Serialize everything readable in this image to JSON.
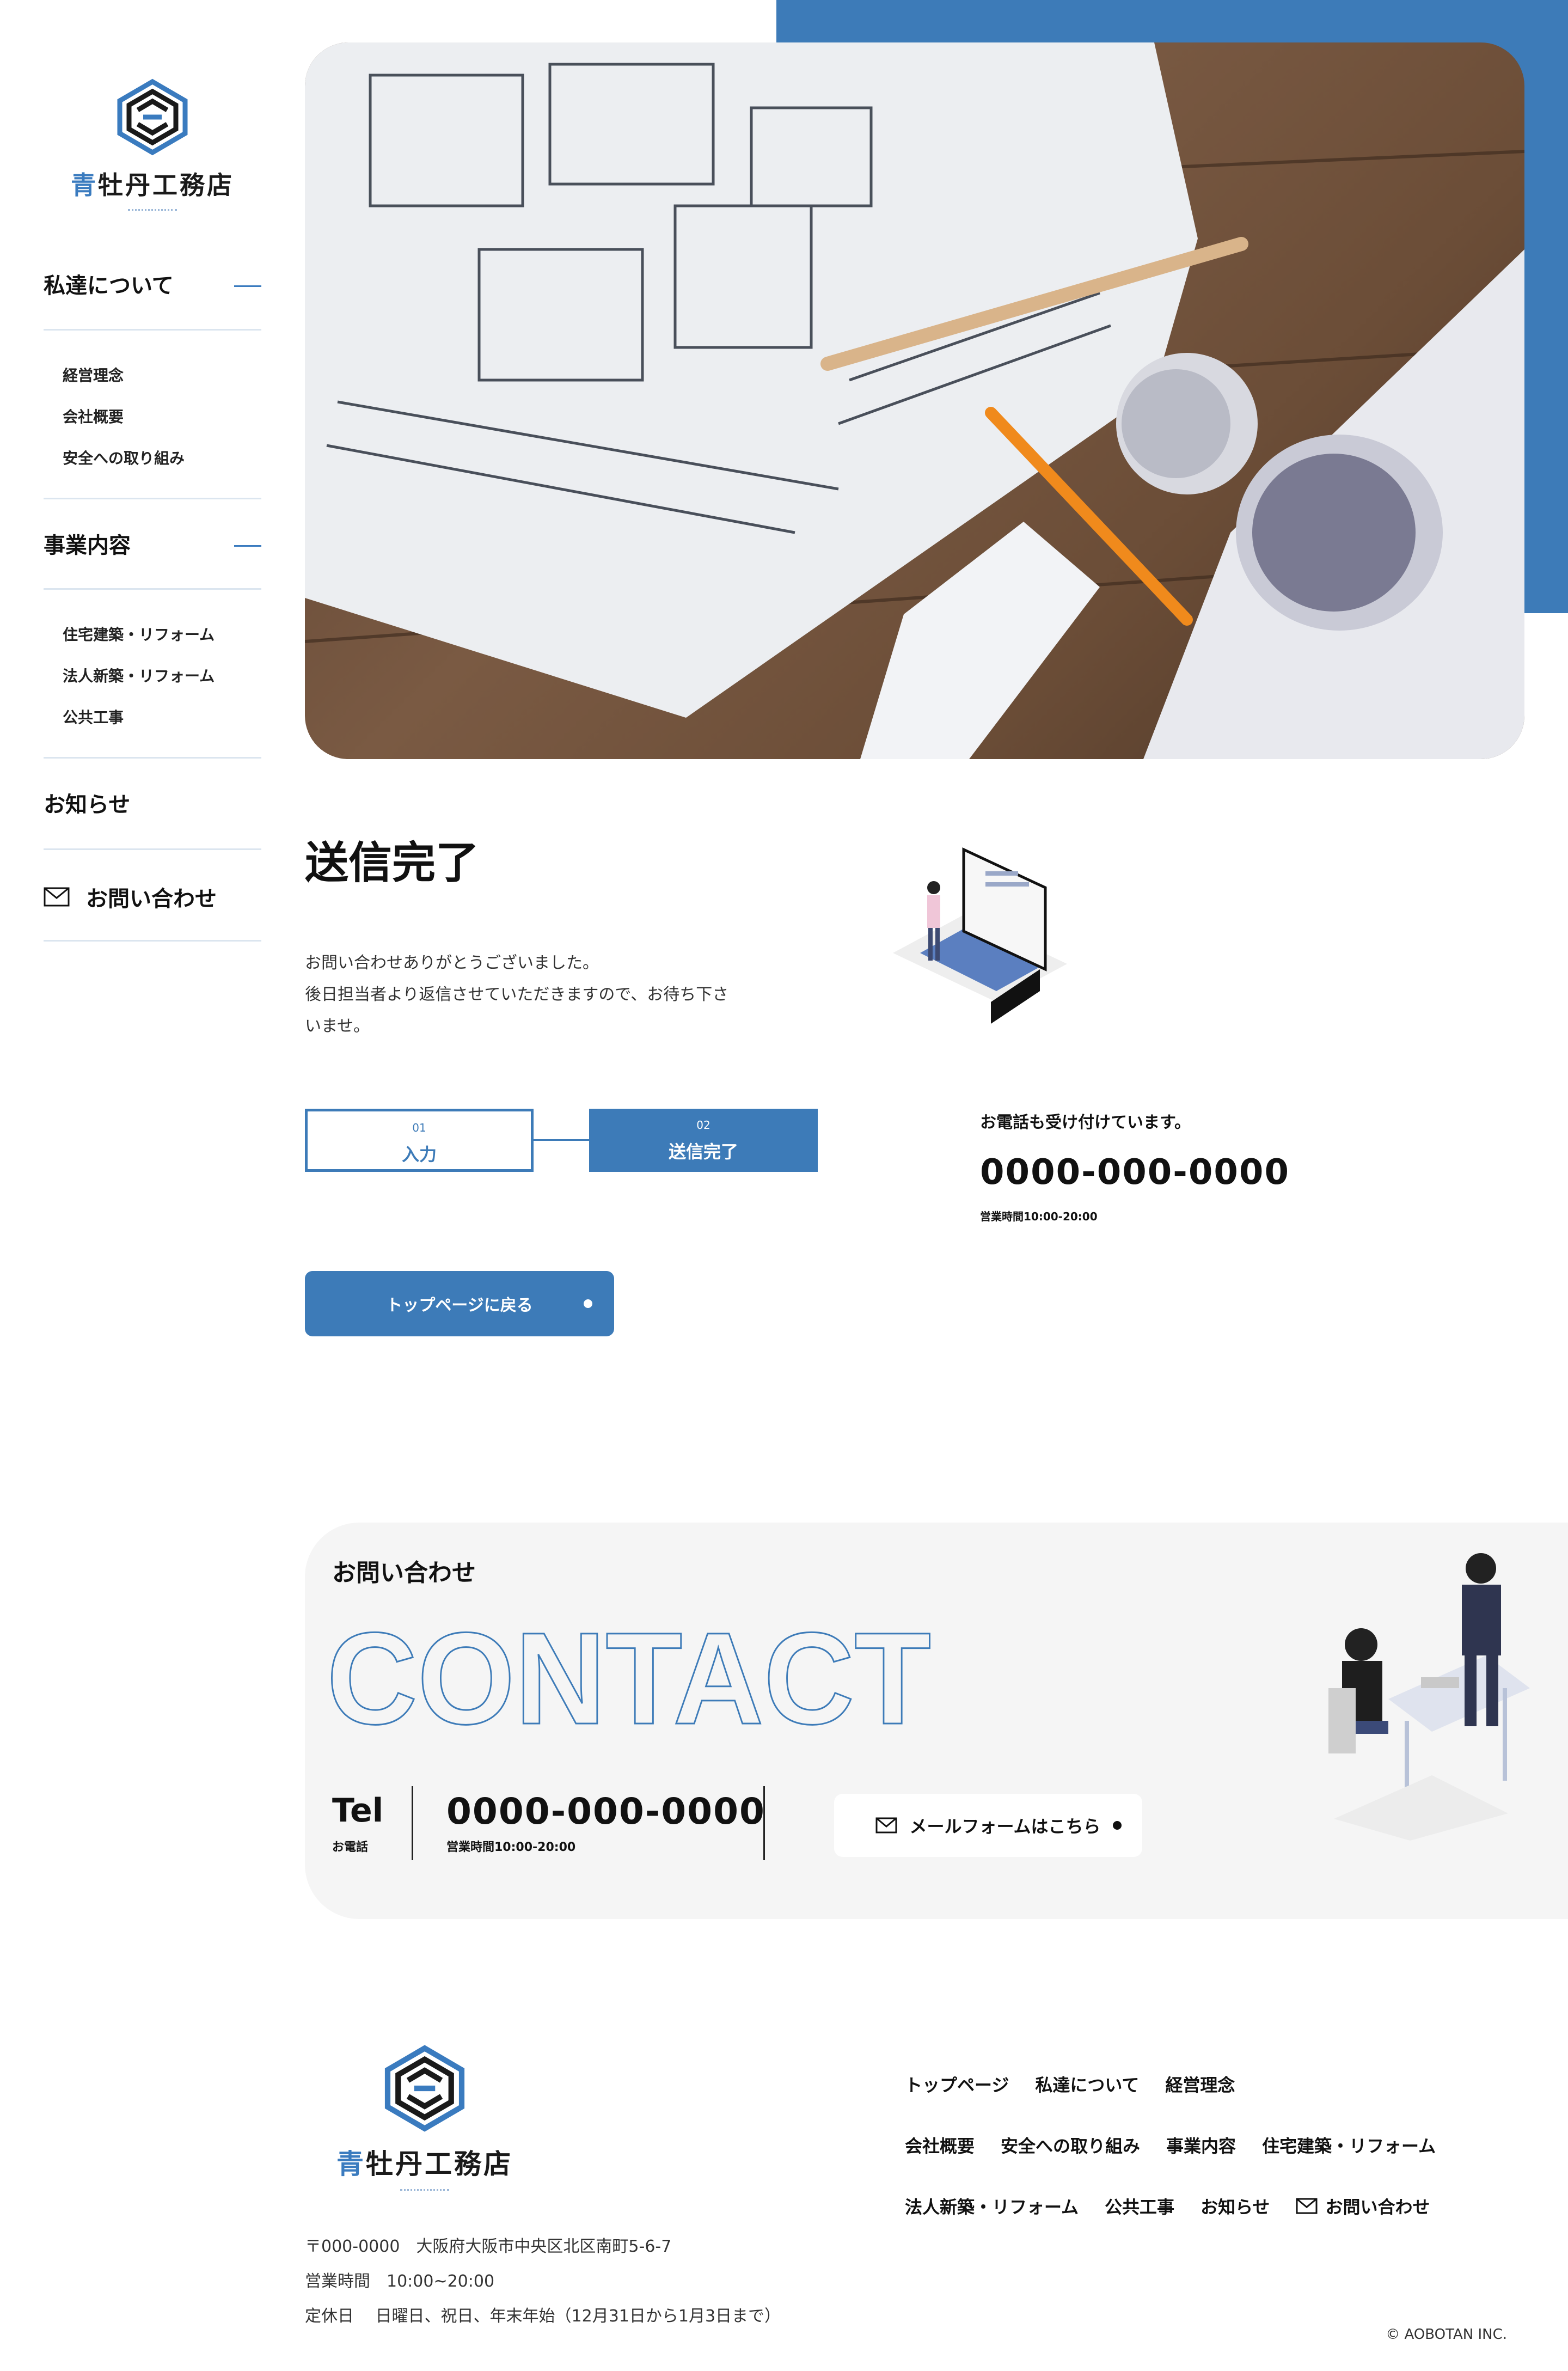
{
  "brand": {
    "name_blue": "青",
    "name_rest": "牡丹工務店"
  },
  "sidebar": {
    "sections": [
      {
        "label": "私達について",
        "items": [
          "経営理念",
          "会社概要",
          "安全への取り組み"
        ]
      },
      {
        "label": "事業内容",
        "items": [
          "住宅建築・リフォーム",
          "法人新築・リフォーム",
          "公共工事"
        ]
      }
    ],
    "news": "お知らせ",
    "contact": "お問い合わせ"
  },
  "main": {
    "title": "送信完了",
    "message": [
      "お問い合わせありがとうございました。",
      "後日担当者より返信させていただきますので、お待ち下さ",
      "いませ。"
    ],
    "steps": [
      {
        "num": "01",
        "label": "入力"
      },
      {
        "num": "02",
        "label": "送信完了"
      }
    ],
    "phone_intro": "お電話も受け付けています。",
    "phone": "0000-000-0000",
    "hours": "営業時間10:00-20:00",
    "back_button": "トップページに戻る"
  },
  "contact": {
    "heading": "お問い合わせ",
    "big": "CONTACT",
    "tel_label": "Tel",
    "tel_sub": "お電話",
    "phone": "0000-000-0000",
    "hours": "営業時間10:00-20:00",
    "mail_button": "メールフォームはこちら"
  },
  "footer": {
    "address": "〒000-0000　大阪府大阪市中央区北区南町5-6-7",
    "hours": "営業時間　10:00~20:00",
    "holiday": "定休日　 日曜日、祝日、年末年始（12月31日から1月3日まで）",
    "nav_row1": [
      "トップページ",
      "私達について",
      "経営理念"
    ],
    "nav_row2": [
      "会社概要",
      "安全への取り組み",
      "事業内容",
      "住宅建築・リフォーム"
    ],
    "nav_row3": [
      "法人新築・リフォーム",
      "公共工事",
      "お知らせ",
      "お問い合わせ"
    ],
    "copyright": "© AOBOTAN INC."
  },
  "colors": {
    "accent": "#3d7bb8",
    "panel": "#f5f5f5"
  }
}
